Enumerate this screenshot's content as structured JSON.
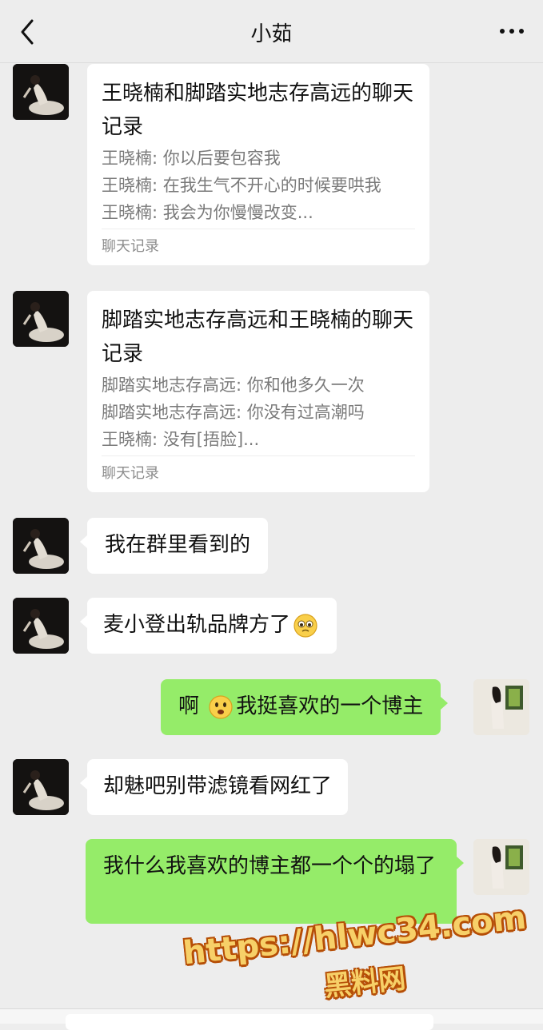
{
  "header": {
    "title": "小茹",
    "back_icon": "chevron-left-icon",
    "more_icon": "more-dots-icon"
  },
  "messages": [
    {
      "type": "chat_record",
      "side": "left",
      "title": "王晓楠和脚踏实地志存高远的聊天记录",
      "lines": [
        "王晓楠: 你以后要包容我",
        "王晓楠: 在我生气不开心的时候要哄我",
        "王晓楠: 我会为你慢慢改变..."
      ],
      "footer": "聊天记录"
    },
    {
      "type": "chat_record",
      "side": "left",
      "title": "脚踏实地志存高远和王晓楠的聊天记录",
      "lines": [
        "脚踏实地志存高远: 你和他多久一次",
        "脚踏实地志存高远: 你没有过高潮吗",
        "王晓楠: 没有[捂脸]..."
      ],
      "footer": "聊天记录"
    },
    {
      "type": "text",
      "side": "left",
      "text": "我在群里看到的"
    },
    {
      "type": "text",
      "side": "left",
      "text": "麦小登出轨品牌方了",
      "emoji": "pleading-face-emoji"
    },
    {
      "type": "text",
      "side": "right",
      "pre": "啊",
      "emoji": "anguished-face-emoji",
      "text": "我挺喜欢的一个博主"
    },
    {
      "type": "text",
      "side": "left",
      "text": "却魅吧别带滤镜看网红了"
    },
    {
      "type": "text",
      "side": "right",
      "text": "我什么我喜欢的博主都一个个的塌了"
    }
  ],
  "watermark": {
    "url": "https://hlwc34.com",
    "name": "黑料网"
  }
}
